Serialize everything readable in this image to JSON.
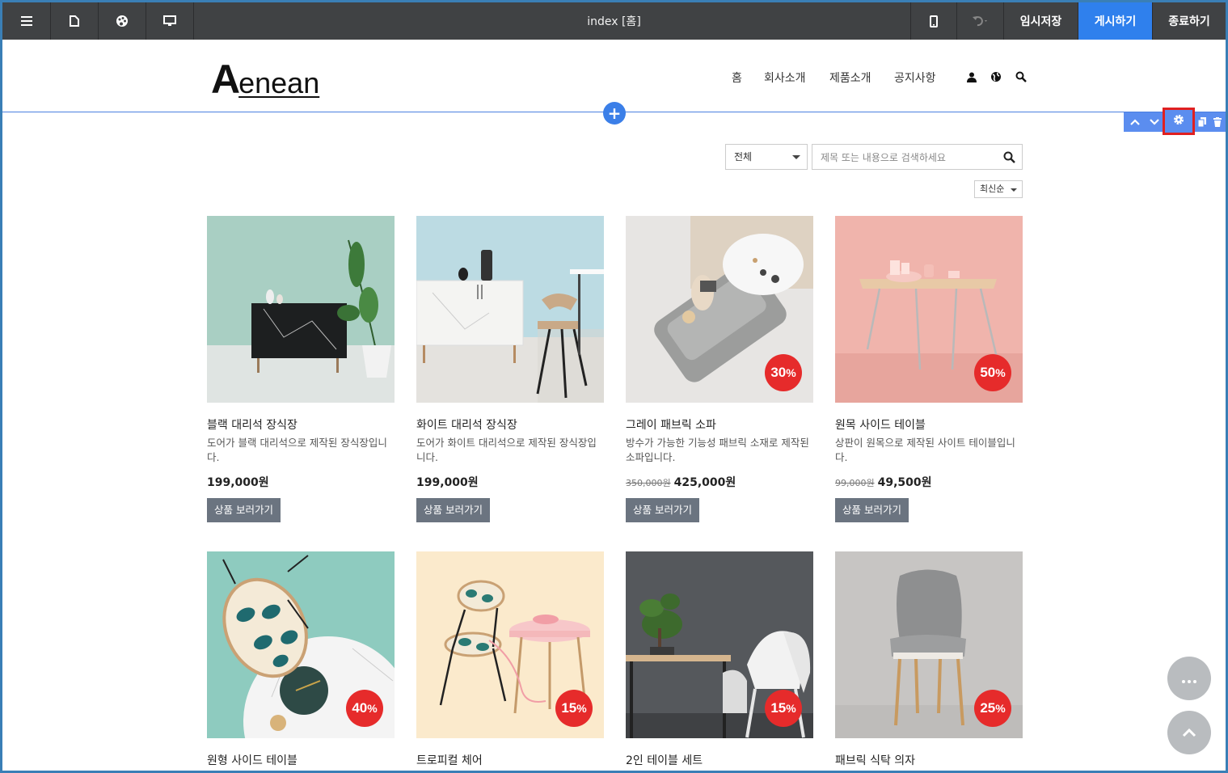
{
  "toolbar": {
    "title": "index [홈]",
    "temp_save": "임시저장",
    "publish": "게시하기",
    "exit": "종료하기",
    "icons": [
      "menu-icon",
      "page-icon",
      "palette-icon",
      "desktop-icon",
      "mobile-icon",
      "undo-icon"
    ]
  },
  "site": {
    "logo_initial": "A",
    "logo_rest": "enean",
    "nav": [
      "홈",
      "회사소개",
      "제품소개",
      "공지사항"
    ],
    "header_icons": [
      "user-icon",
      "globe-icon",
      "search-icon"
    ]
  },
  "section_tools": [
    "move-up-icon",
    "move-down-icon",
    "settings-icon",
    "copy-icon",
    "delete-icon"
  ],
  "search": {
    "category": "전체",
    "placeholder": "제목 또는 내용으로 검색하세요",
    "sort": "최신순"
  },
  "products": [
    {
      "name": "블랙 대리석 장식장",
      "desc": "도어가 블랙 대리석으로 제작된 장식장입니다.",
      "old_price": "",
      "price": "199,000원",
      "badge": "",
      "button": "상품 보러가기"
    },
    {
      "name": "화이트 대리석 장식장",
      "desc": "도어가 화이트 대리석으로 제작된 장식장입니다.",
      "old_price": "",
      "price": "199,000원",
      "badge": "",
      "button": "상품 보러가기"
    },
    {
      "name": "그레이 패브릭 소파",
      "desc": "방수가 가능한 기능성 패브릭 소재로 제작된 소파입니다.",
      "old_price": "350,000원",
      "price": "425,000원",
      "badge": "30",
      "button": "상품 보러가기"
    },
    {
      "name": "원목 사이드 테이블",
      "desc": "상판이 원목으로 제작된 사이트 테이블입니다.",
      "old_price": "99,000원",
      "price": "49,500원",
      "badge": "50",
      "button": "상품 보러가기"
    },
    {
      "name": "원형 사이드 테이블",
      "desc": "",
      "old_price": "",
      "price": "",
      "badge": "40",
      "button": ""
    },
    {
      "name": "트로피컬 체어",
      "desc": "",
      "old_price": "",
      "price": "",
      "badge": "15",
      "button": ""
    },
    {
      "name": "2인 테이블 세트",
      "desc": "",
      "old_price": "",
      "price": "",
      "badge": "15",
      "button": ""
    },
    {
      "name": "패브릭 식탁 의자",
      "desc": "",
      "old_price": "",
      "price": "",
      "badge": "25",
      "button": ""
    }
  ],
  "badge_unit": "%",
  "colors": {
    "toolbar": "#404244",
    "publish": "#2f80ed",
    "badge": "#e62b2b",
    "highlight": "#e02020"
  }
}
